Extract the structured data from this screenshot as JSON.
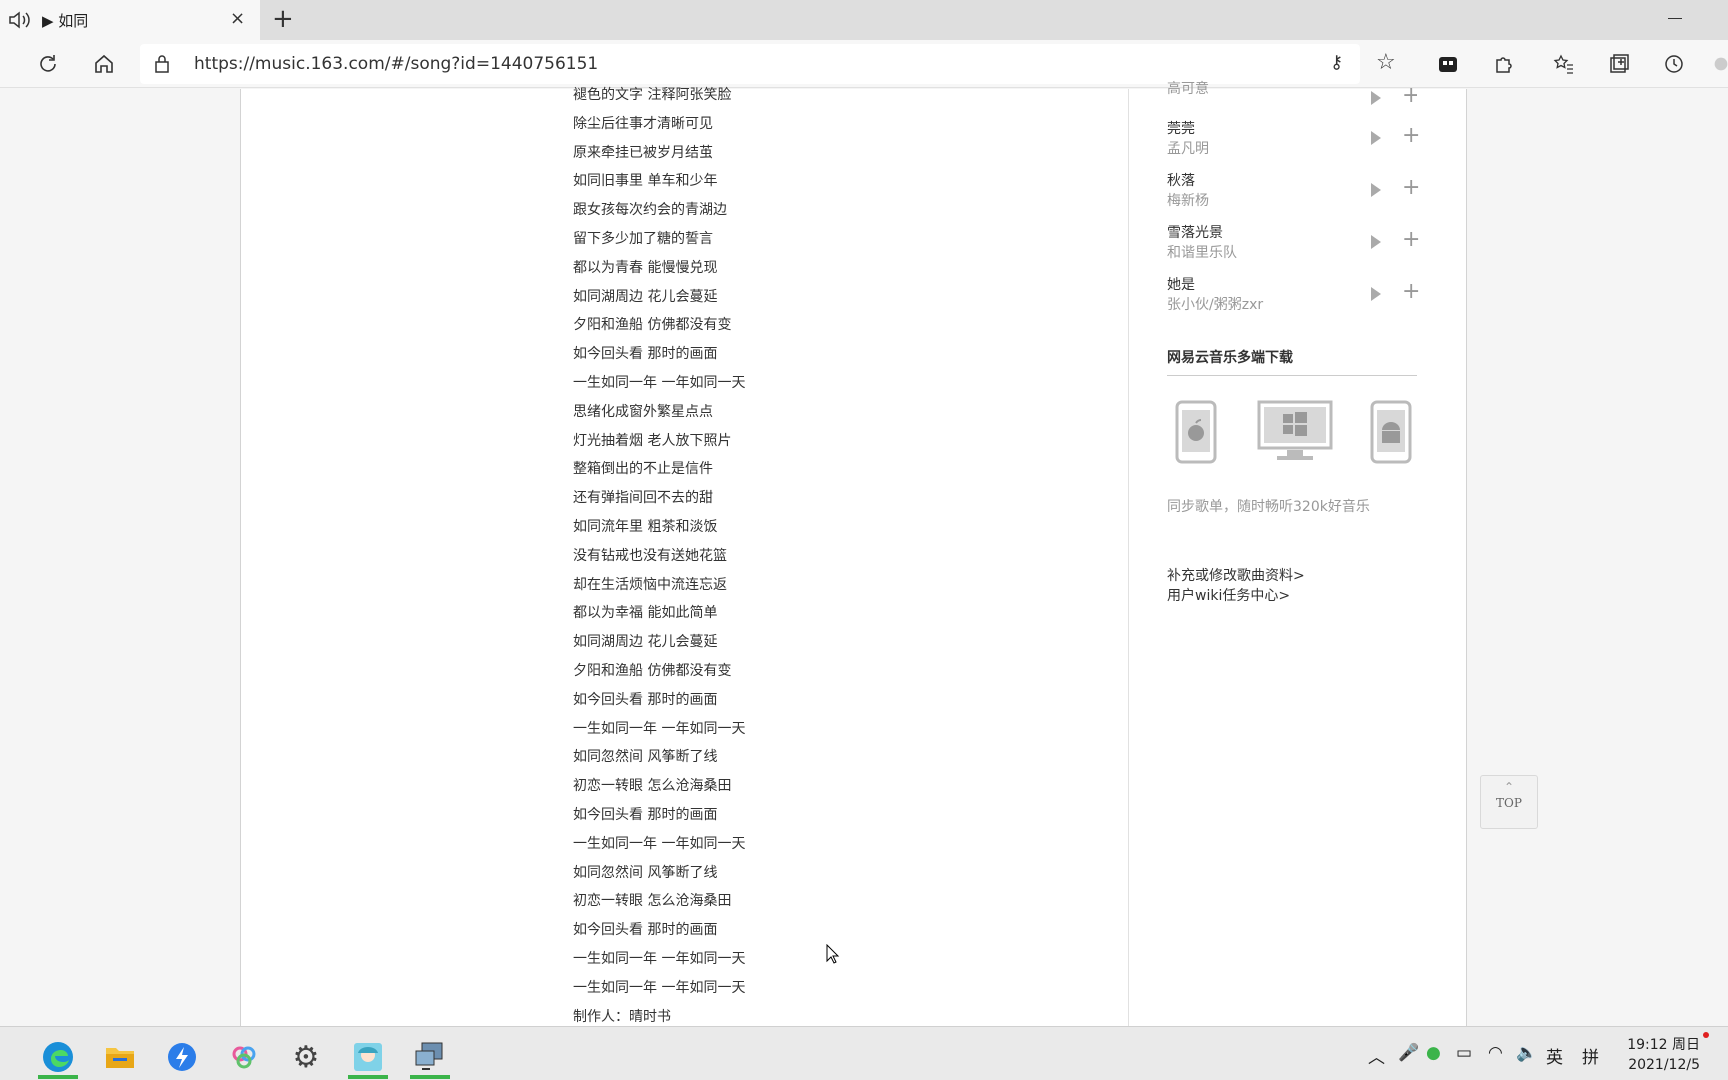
{
  "browser": {
    "tab_title": "▶ 如同",
    "tab_close": "×",
    "new_tab": "+",
    "url": "https://music.163.com/#/song?id=1440756151"
  },
  "lyrics": [
    "褪色的文字 注释阿张笑脸",
    "除尘后往事才清晰可见",
    "原来牵挂已被岁月结茧",
    "如同旧事里 单车和少年",
    "跟女孩每次约会的青湖边",
    "留下多少加了糖的誓言",
    "都以为青春 能慢慢兑现",
    "如同湖周边 花儿会蔓延",
    "夕阳和渔船 仿佛都没有变",
    "如今回头看 那时的画面",
    "一生如同一年 一年如同一天",
    "思绪化成窗外繁星点点",
    "灯光抽着烟 老人放下照片",
    "整箱倒出的不止是信件",
    "还有弹指间回不去的甜",
    "如同流年里 粗茶和淡饭",
    "没有钻戒也没有送她花篮",
    "却在生活烦恼中流连忘返",
    "都以为幸福 能如此简单",
    "如同湖周边 花儿会蔓延",
    "夕阳和渔船 仿佛都没有变",
    "如今回头看 那时的画面",
    "一生如同一年 一年如同一天",
    "如同忽然间 风筝断了线",
    "初恋一转眼 怎么沧海桑田",
    "如今回头看 那时的画面",
    "一生如同一年 一年如同一天",
    "如同忽然间 风筝断了线",
    "初恋一转眼 怎么沧海桑田",
    "如今回头看 那时的画面",
    "一生如同一年 一年如同一天",
    "一生如同一年 一年如同一天",
    "制作人：晴时书"
  ],
  "similar_songs": [
    {
      "name": "",
      "artist": "高可意"
    },
    {
      "name": "莞莞",
      "artist": "孟凡明"
    },
    {
      "name": "秋落",
      "artist": "梅新杨"
    },
    {
      "name": "雪落光景",
      "artist": "和谐里乐队"
    },
    {
      "name": "她是",
      "artist": "张小伙/粥粥zxr"
    }
  ],
  "download": {
    "title": "网易云音乐多端下载",
    "desc": "同步歌单，随时畅听320k好音乐"
  },
  "wiki": {
    "link1": "补充或修改歌曲资料>",
    "link2": "用户wiki任务中心>"
  },
  "top_button": {
    "arrow": "⌃",
    "label": "TOP"
  },
  "taskbar": {
    "ime_lang": "英",
    "ime_mode": "拼",
    "time": "19:12 周日",
    "date": "2021/12/5"
  }
}
